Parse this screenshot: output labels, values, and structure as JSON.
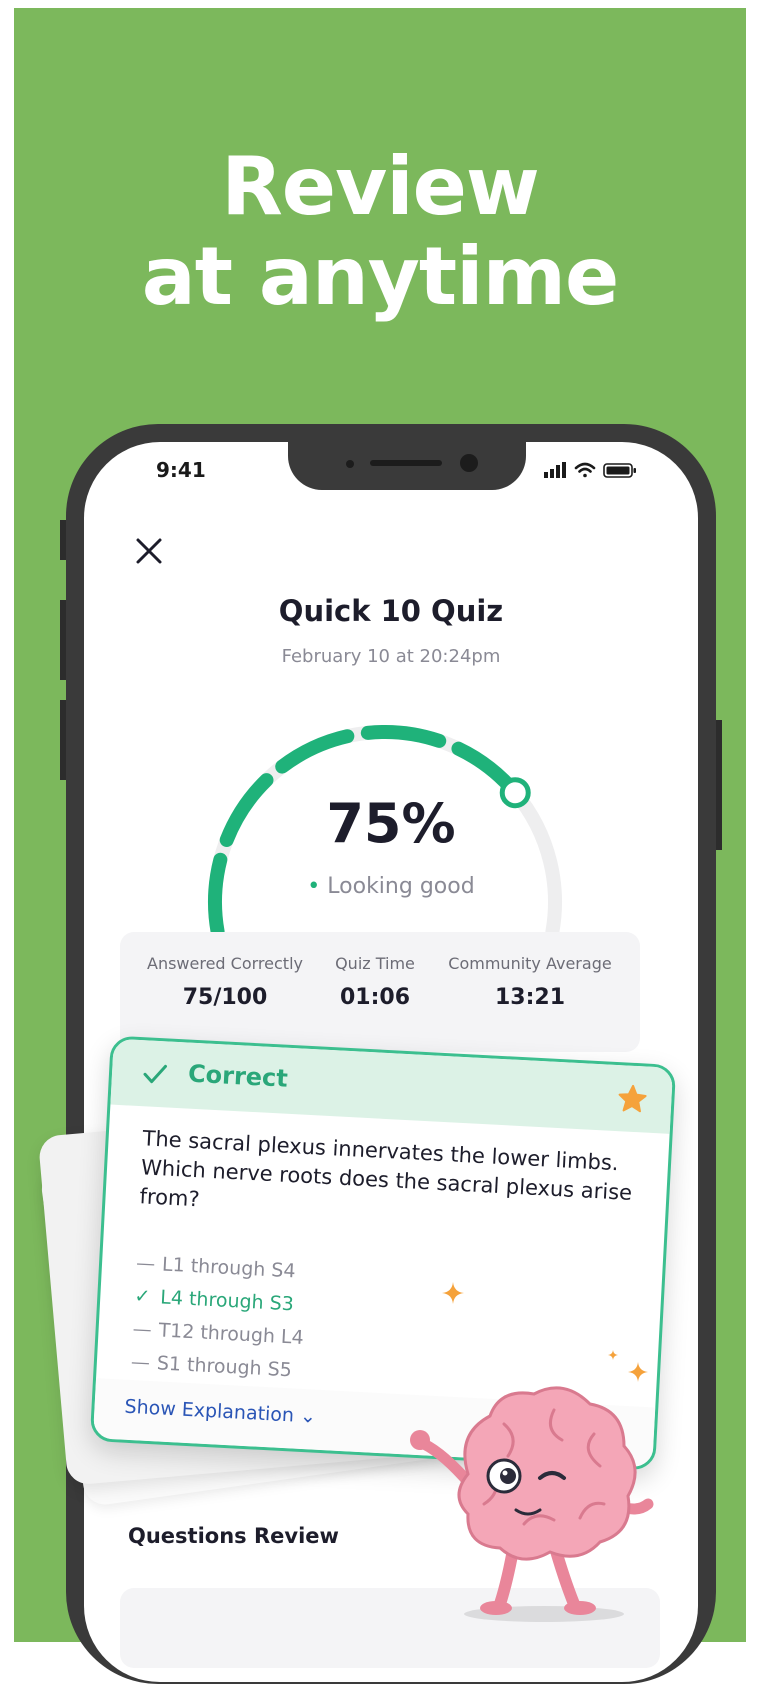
{
  "promo": {
    "line1": "Review",
    "line2": "at anytime"
  },
  "status_bar": {
    "time": "9:41"
  },
  "quiz": {
    "title": "Quick 10 Quiz",
    "date": "February 10 at 20:24pm",
    "score": "75%",
    "score_fraction": 0.75,
    "status": "Looking good"
  },
  "stats": [
    {
      "label": "Answered Correctly",
      "value": "75/100"
    },
    {
      "label": "Quiz Time",
      "value": "01:06"
    },
    {
      "label": "Community Average",
      "value": "13:21"
    }
  ],
  "card": {
    "header": "Correct",
    "question": "The sacral plexus innervates the lower limbs. Which nerve roots does the sacral plexus arise from?",
    "options": [
      {
        "text": "L1 through S4",
        "correct": false
      },
      {
        "text": "L4 through S3",
        "correct": true
      },
      {
        "text": "T12 through L4",
        "correct": false
      },
      {
        "text": "S1 through S5",
        "correct": false
      }
    ],
    "explanation_label": "Show Explanation ⌄"
  },
  "questions_review": {
    "title": "Questions Review"
  },
  "colors": {
    "background": "#7cb85c",
    "accent": "#1fb27a",
    "card_border": "#3cbf8f",
    "star": "#f5a23b",
    "link": "#2a55b6"
  },
  "icons": [
    "close-icon",
    "signal-icon",
    "wifi-icon",
    "battery-icon",
    "check-icon",
    "star-icon",
    "sparkle-icon",
    "brain-mascot"
  ]
}
